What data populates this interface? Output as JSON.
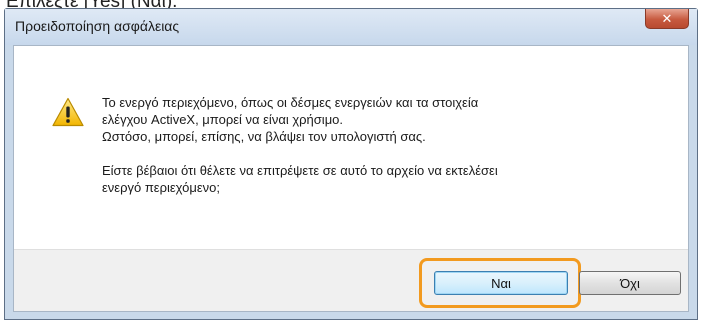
{
  "caption": "Επιλέξτε [Yes] (Ναι).",
  "dialog": {
    "title": "Προειδοποίηση ασφάλειας",
    "close_glyph": "✕",
    "icon": "warning-icon",
    "message": {
      "line1": "Το ενεργό περιεχόμενο, όπως οι δέσμες ενεργειών και τα στοιχεία",
      "line2": "ελέγχου ActiveX, μπορεί να είναι χρήσιμο.",
      "line3": "Ωστόσο, μπορεί, επίσης, να βλάψει τον υπολογιστή σας.",
      "line4": "Είστε βέβαιοι ότι θέλετε να επιτρέψετε σε αυτό το αρχείο να εκτελέσει",
      "line5": "ενεργό περιεχόμενο;"
    },
    "buttons": {
      "yes": "Ναι",
      "no": "Όχι"
    }
  },
  "colors": {
    "highlight": "#f29a1f",
    "close_button": "#c75a3f",
    "titlebar": "#c7d8ec"
  }
}
